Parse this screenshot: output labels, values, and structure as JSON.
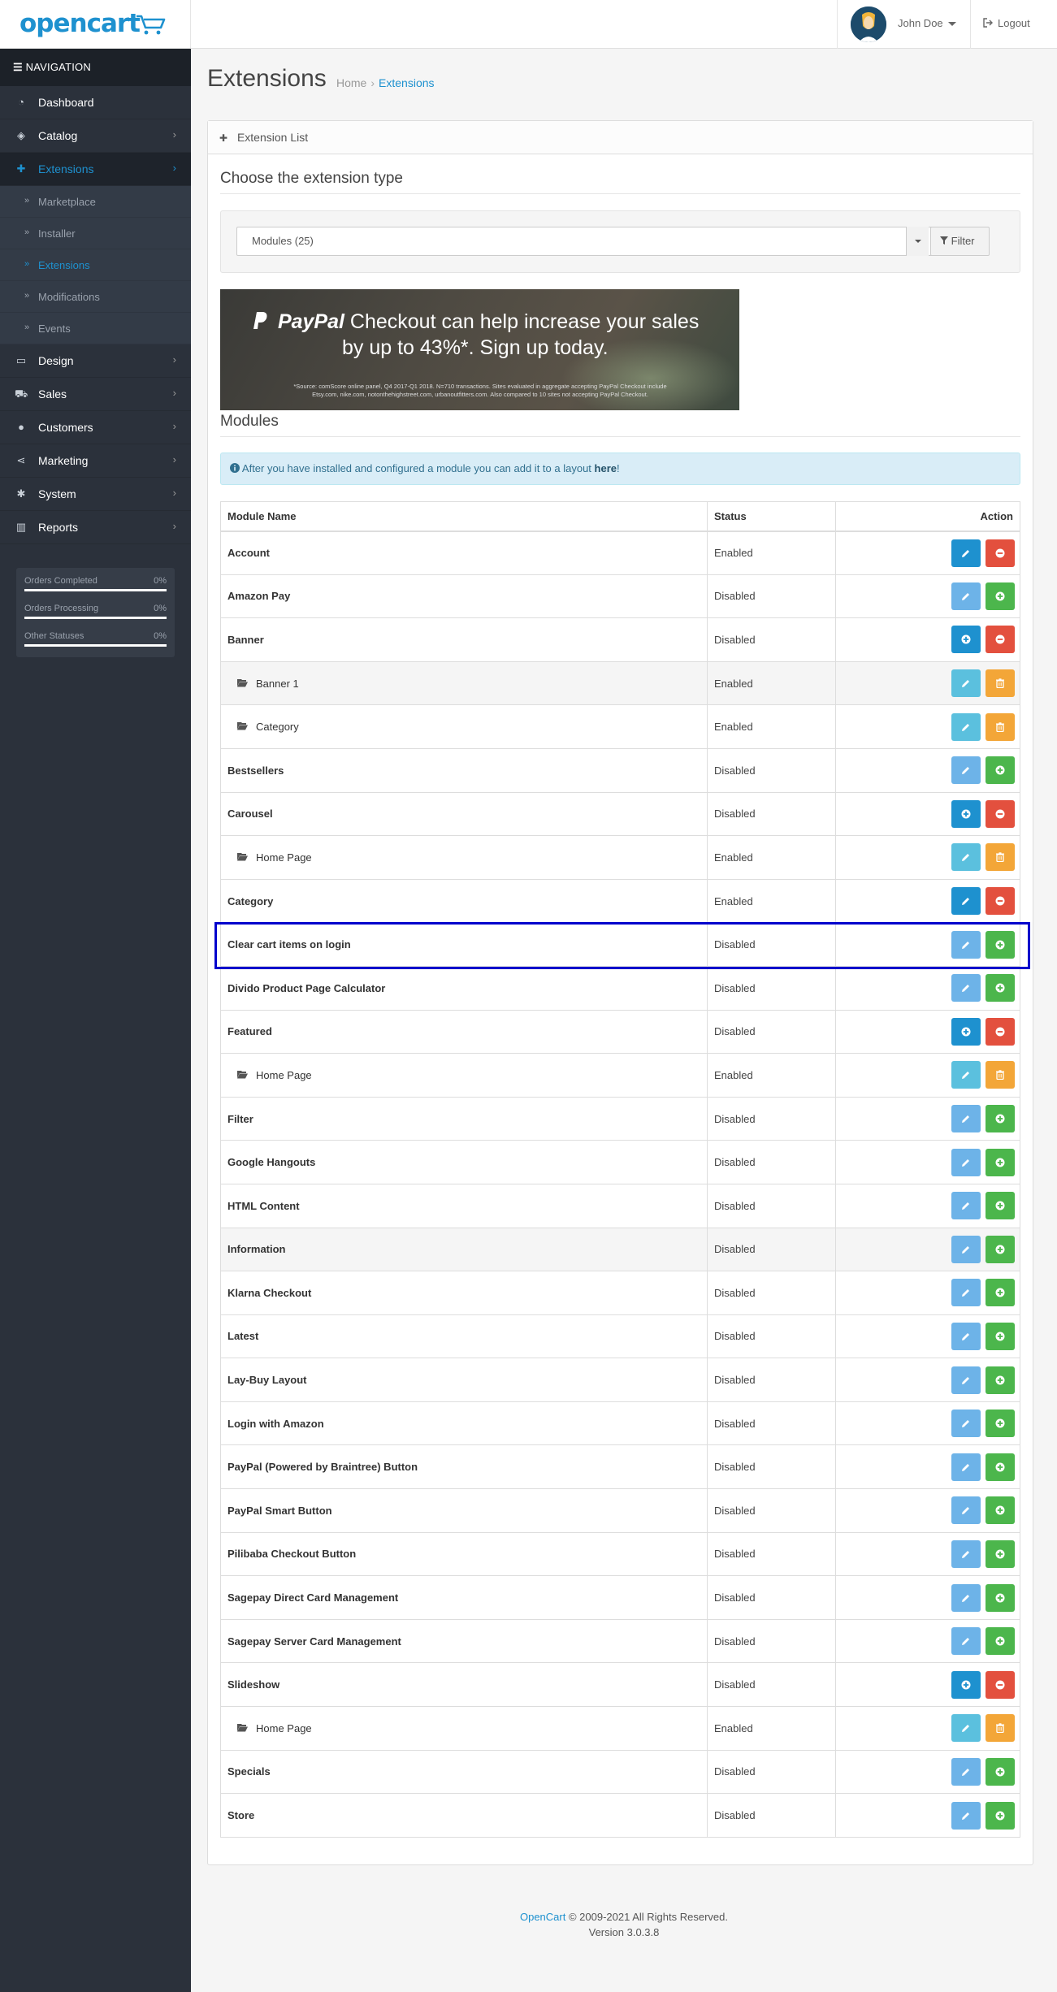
{
  "header": {
    "logo": "opencart",
    "user_name": "John Doe",
    "logout_label": "Logout"
  },
  "navigation": {
    "title": "NAVIGATION",
    "items": [
      {
        "label": "Dashboard",
        "icon": "dashboard-icon"
      },
      {
        "label": "Catalog",
        "icon": "tags-icon"
      },
      {
        "label": "Extensions",
        "icon": "puzzle-icon"
      },
      {
        "label": "Design",
        "icon": "desktop-icon"
      },
      {
        "label": "Sales",
        "icon": "cart-icon"
      },
      {
        "label": "Customers",
        "icon": "user-icon"
      },
      {
        "label": "Marketing",
        "icon": "share-icon"
      },
      {
        "label": "System",
        "icon": "gear-icon"
      },
      {
        "label": "Reports",
        "icon": "bar-chart-icon"
      }
    ],
    "extensions_sub": [
      "Marketplace",
      "Installer",
      "Extensions",
      "Modifications",
      "Events"
    ]
  },
  "stats": [
    {
      "label": "Orders Completed",
      "percent": "0%"
    },
    {
      "label": "Orders Processing",
      "percent": "0%"
    },
    {
      "label": "Other Statuses",
      "percent": "0%"
    }
  ],
  "page": {
    "title": "Extensions",
    "breadcrumb": [
      "Home",
      "Extensions"
    ]
  },
  "panel": {
    "heading": "Extension List",
    "choose_title": "Choose the extension type",
    "type_selected": "Modules (25)",
    "filter_label": "Filter"
  },
  "banner": {
    "brand": "PayPal",
    "line1_rest": " Checkout can help increase your sales",
    "line2": "by up to 43%*. Sign up today.",
    "fine_print": "*Source: comScore online panel, Q4 2017-Q1 2018. N=710 transactions. Sites evaluated in aggregate accepting PayPal Checkout include Etsy.com, nike.com, notonthehighstreet.com, urbanoutfitters.com. Also compared to 10 sites not accepting PayPal Checkout."
  },
  "modules": {
    "title": "Modules",
    "alert_text": "After you have installed and configured a module you can add it to a layout ",
    "alert_link": "here",
    "alert_end": "!",
    "columns": [
      "Module Name",
      "Status",
      "Action"
    ],
    "rows": [
      {
        "name": "Account",
        "status": "Enabled",
        "child": false,
        "buttons": [
          "edit-primary",
          "uninstall"
        ]
      },
      {
        "name": "Amazon Pay",
        "status": "Disabled",
        "child": false,
        "buttons": [
          "edit-light",
          "install"
        ]
      },
      {
        "name": "Banner",
        "status": "Disabled",
        "child": false,
        "buttons": [
          "add",
          "uninstall"
        ]
      },
      {
        "name": "Banner 1",
        "status": "Enabled",
        "child": true,
        "buttons": [
          "edit-info",
          "delete"
        ]
      },
      {
        "name": "Category",
        "status": "Enabled",
        "child": true,
        "buttons": [
          "edit-info",
          "delete"
        ]
      },
      {
        "name": "Bestsellers",
        "status": "Disabled",
        "child": false,
        "buttons": [
          "edit-light",
          "install"
        ]
      },
      {
        "name": "Carousel",
        "status": "Disabled",
        "child": false,
        "buttons": [
          "add",
          "uninstall"
        ]
      },
      {
        "name": "Home Page",
        "status": "Enabled",
        "child": true,
        "buttons": [
          "edit-info",
          "delete"
        ]
      },
      {
        "name": "Category",
        "status": "Enabled",
        "child": false,
        "buttons": [
          "edit-primary",
          "uninstall"
        ]
      },
      {
        "name": "Clear cart items on login",
        "status": "Disabled",
        "child": false,
        "buttons": [
          "edit-light",
          "install"
        ]
      },
      {
        "name": "Divido Product Page Calculator",
        "status": "Disabled",
        "child": false,
        "buttons": [
          "edit-light",
          "install"
        ]
      },
      {
        "name": "Featured",
        "status": "Disabled",
        "child": false,
        "buttons": [
          "add",
          "uninstall"
        ]
      },
      {
        "name": "Home Page",
        "status": "Enabled",
        "child": true,
        "buttons": [
          "edit-info",
          "delete"
        ]
      },
      {
        "name": "Filter",
        "status": "Disabled",
        "child": false,
        "buttons": [
          "edit-light",
          "install"
        ]
      },
      {
        "name": "Google Hangouts",
        "status": "Disabled",
        "child": false,
        "buttons": [
          "edit-light",
          "install"
        ]
      },
      {
        "name": "HTML Content",
        "status": "Disabled",
        "child": false,
        "buttons": [
          "edit-light",
          "install"
        ]
      },
      {
        "name": "Information",
        "status": "Disabled",
        "child": false,
        "buttons": [
          "edit-light",
          "install"
        ]
      },
      {
        "name": "Klarna Checkout",
        "status": "Disabled",
        "child": false,
        "buttons": [
          "edit-light",
          "install"
        ]
      },
      {
        "name": "Latest",
        "status": "Disabled",
        "child": false,
        "buttons": [
          "edit-light",
          "install"
        ]
      },
      {
        "name": "Lay-Buy Layout",
        "status": "Disabled",
        "child": false,
        "buttons": [
          "edit-light",
          "install"
        ]
      },
      {
        "name": "Login with Amazon",
        "status": "Disabled",
        "child": false,
        "buttons": [
          "edit-light",
          "install"
        ]
      },
      {
        "name": "PayPal (Powered by Braintree) Button",
        "status": "Disabled",
        "child": false,
        "buttons": [
          "edit-light",
          "install"
        ]
      },
      {
        "name": "PayPal Smart Button",
        "status": "Disabled",
        "child": false,
        "buttons": [
          "edit-light",
          "install"
        ]
      },
      {
        "name": "Pilibaba Checkout Button",
        "status": "Disabled",
        "child": false,
        "buttons": [
          "edit-light",
          "install"
        ]
      },
      {
        "name": "Sagepay Direct Card Management",
        "status": "Disabled",
        "child": false,
        "buttons": [
          "edit-light",
          "install"
        ]
      },
      {
        "name": "Sagepay Server Card Management",
        "status": "Disabled",
        "child": false,
        "buttons": [
          "edit-light",
          "install"
        ]
      },
      {
        "name": "Slideshow",
        "status": "Disabled",
        "child": false,
        "buttons": [
          "add",
          "uninstall"
        ]
      },
      {
        "name": "Home Page",
        "status": "Enabled",
        "child": true,
        "buttons": [
          "edit-info",
          "delete"
        ]
      },
      {
        "name": "Specials",
        "status": "Disabled",
        "child": false,
        "buttons": [
          "edit-light",
          "install"
        ]
      },
      {
        "name": "Store",
        "status": "Disabled",
        "child": false,
        "buttons": [
          "edit-light",
          "install"
        ]
      }
    ]
  },
  "footer": {
    "brand": "OpenCart",
    "copyright": " © 2009-2021 All Rights Reserved.",
    "version": "Version 3.0.3.8"
  },
  "colors": {
    "brand_blue": "#1e91cf",
    "sidebar_bg": "#2b313b",
    "success": "#4cb64c",
    "danger": "#e3503e",
    "warning": "#f3a638",
    "highlight_outline": "#0000cc"
  }
}
